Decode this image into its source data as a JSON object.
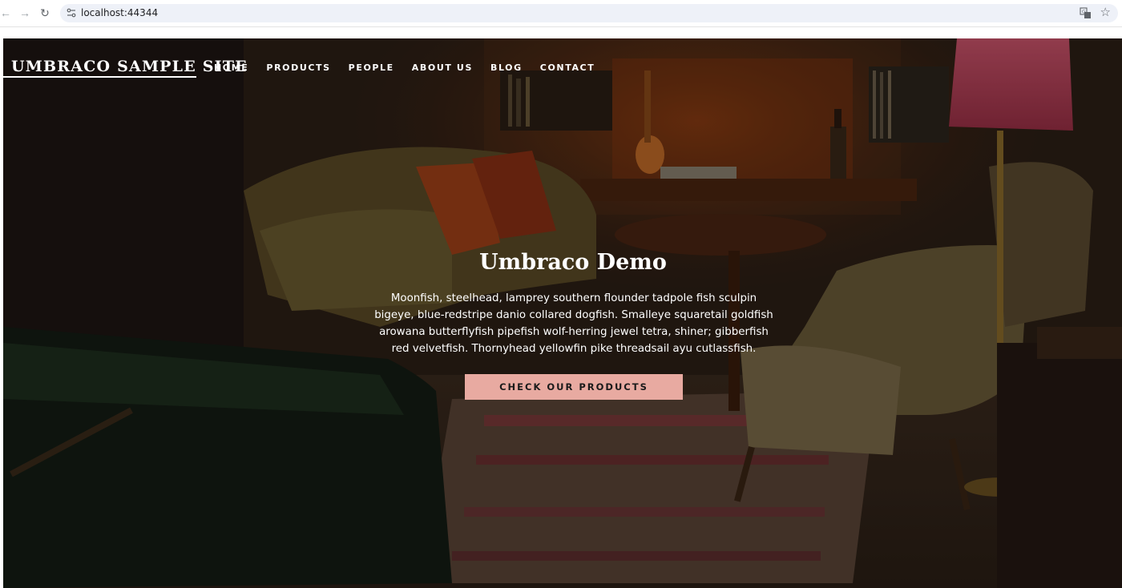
{
  "browser": {
    "url": "localhost:44344"
  },
  "site": {
    "brand": "UMBRACO SAMPLE SITE",
    "nav": [
      "HOME",
      "PRODUCTS",
      "PEOPLE",
      "ABOUT US",
      "BLOG",
      "CONTACT"
    ]
  },
  "hero": {
    "title": "Umbraco Demo",
    "text": "Moonfish, steelhead, lamprey southern flounder tadpole fish sculpin bigeye, blue-redstripe danio collared dogfish. Smalleye squaretail goldfish arowana butterflyfish pipefish wolf-herring jewel tetra, shiner; gibberfish red velvetfish. Thornyhead yellowfin pike threadsail ayu cutlassfish.",
    "button": "CHECK OUR PRODUCTS"
  },
  "colors": {
    "button_bg": "#e8aaa1",
    "hero_overlay": "#000000"
  }
}
